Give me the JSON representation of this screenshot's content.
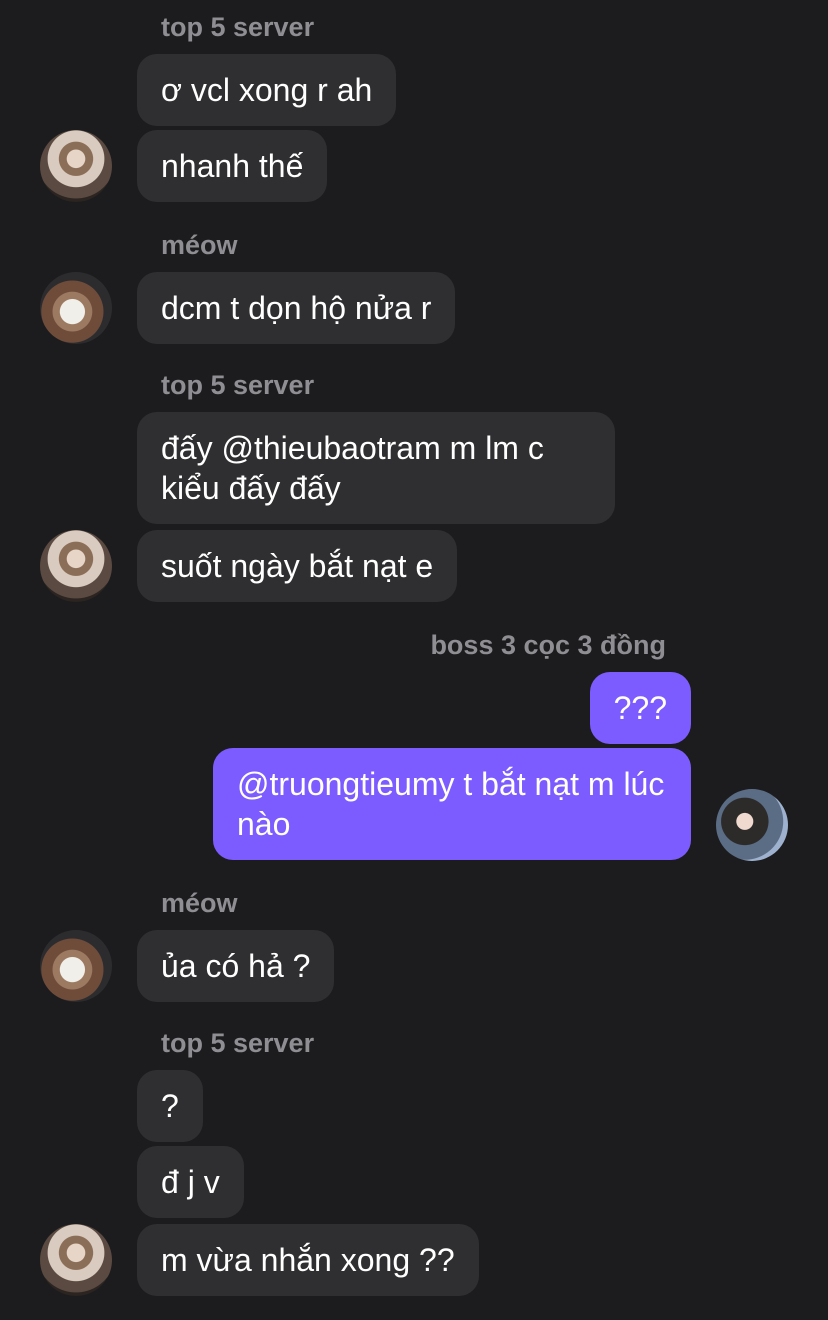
{
  "senders": {
    "top5": "top 5 server",
    "meow": "méow",
    "boss": "boss 3 cọc 3 đồng"
  },
  "messages": {
    "m1": "ơ vcl xong r ah",
    "m2": "nhanh thế",
    "m3": "dcm t dọn hộ nửa r",
    "m4": "đấy @thieubaotram m lm c kiểu đấy đấy",
    "m5": "suốt ngày bắt nạt e",
    "m6": "???",
    "m7": "@truongtieumy t bắt nạt m lúc nào",
    "m8": "ủa có hả ?",
    "m9": "?",
    "m10": "đ j v",
    "m11": "m vừa nhắn xong ??"
  },
  "colors": {
    "background": "#1c1c1e",
    "incoming_bubble": "#2f2f31",
    "outgoing_bubble": "#7d5cff",
    "sender_name": "#8e8e93"
  },
  "icons": {
    "avatar_top5": "avatar",
    "avatar_meow": "avatar",
    "avatar_self": "avatar"
  }
}
